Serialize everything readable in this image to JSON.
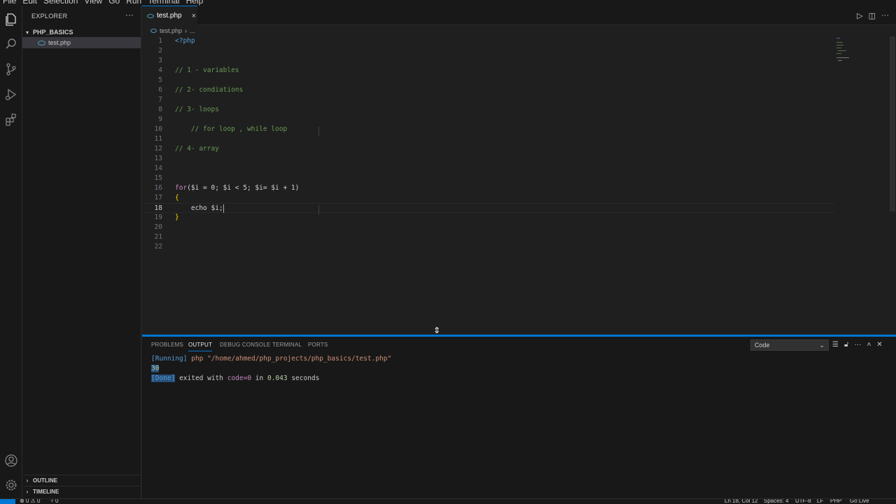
{
  "menu": [
    "File",
    "Edit",
    "Selection",
    "View",
    "Go",
    "Run",
    "Terminal",
    "Help"
  ],
  "sidebar": {
    "title": "EXPLORER",
    "more": "···",
    "folder": "PHP_BASICS",
    "file": "test.php",
    "outline": "OUTLINE",
    "timeline": "TIMELINE"
  },
  "tabs": [
    {
      "label": "test.php",
      "close": "×"
    }
  ],
  "breadcrumb": {
    "file": "test.php",
    "rest": "..."
  },
  "editor": {
    "current_line": 18,
    "lines": [
      {
        "n": "1",
        "text": "<?php"
      },
      {
        "n": "2",
        "text": ""
      },
      {
        "n": "3",
        "text": ""
      },
      {
        "n": "4",
        "text": "// 1 - variables"
      },
      {
        "n": "5",
        "text": ""
      },
      {
        "n": "6",
        "text": "// 2- condiations"
      },
      {
        "n": "7",
        "text": ""
      },
      {
        "n": "8",
        "text": "// 3- loops"
      },
      {
        "n": "9",
        "text": ""
      },
      {
        "n": "10",
        "text": "    // for loop , while loop"
      },
      {
        "n": "11",
        "text": ""
      },
      {
        "n": "12",
        "text": "// 4- array"
      },
      {
        "n": "13",
        "text": ""
      },
      {
        "n": "14",
        "text": ""
      },
      {
        "n": "15",
        "text": ""
      },
      {
        "n": "16",
        "text": "for($i = 0; $i < 5; $i= $i + 1)"
      },
      {
        "n": "17",
        "text": "{"
      },
      {
        "n": "18",
        "text": "    echo $i;"
      },
      {
        "n": "19",
        "text": "}"
      },
      {
        "n": "20",
        "text": ""
      },
      {
        "n": "21",
        "text": ""
      },
      {
        "n": "22",
        "text": ""
      }
    ]
  },
  "panel": {
    "tabs": [
      "PROBLEMS",
      "OUTPUT",
      "DEBUG CONSOLE",
      "TERMINAL",
      "PORTS"
    ],
    "active_tab": "OUTPUT",
    "channel": "Code",
    "output": {
      "running_tag": "[Running]",
      "running_cmd": "php \"/home/ahmed/php_projects/php_basics/test.php\"",
      "result": "30",
      "done_tag": "[Done]",
      "done_a": "exited with",
      "done_code": "code=0",
      "done_b": "in",
      "done_time": "0.043",
      "done_c": "seconds"
    }
  },
  "statusbar": {
    "problems": "⊗ 0 ⚠ 0",
    "ports": "⑂ 0",
    "position": "Ln 18, Col 12",
    "spaces": "Spaces: 4",
    "encoding": "UTF-8",
    "eol": "LF",
    "language": "PHP",
    "golive": "Go Live"
  },
  "colors": {
    "accent": "#0078d4",
    "comment": "#6a9955",
    "keyword": "#c586c0"
  }
}
